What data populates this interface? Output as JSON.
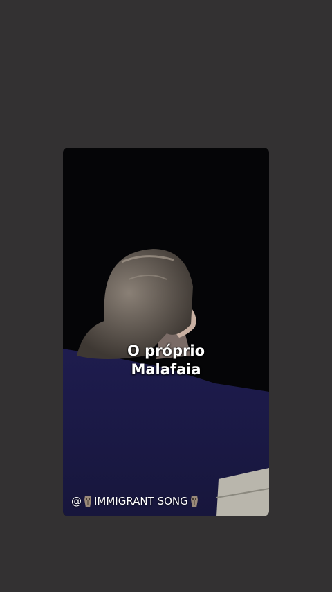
{
  "caption": {
    "line1": "O próprio",
    "line2": "Malafaia"
  },
  "music_tag": {
    "prefix": "@",
    "title": "IMMIGRANT SONG"
  },
  "icons": {
    "music_tag_left": "moai-icon",
    "music_tag_right": "moai-icon"
  },
  "colors": {
    "page_background": "#333132",
    "video_background": "#050507",
    "caption_text": "#ffffff"
  }
}
